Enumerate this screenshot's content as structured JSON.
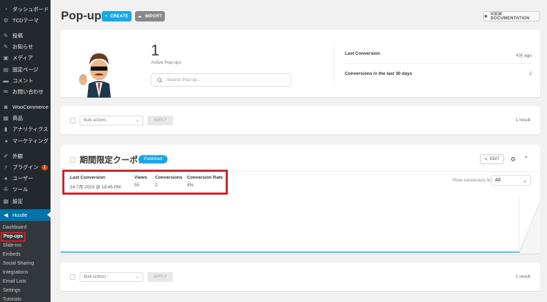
{
  "sidebar": {
    "items": [
      {
        "label": "ダッシュボード",
        "icon": "dashboard-icon"
      },
      {
        "label": "TCDテーマ",
        "icon": "gear-icon"
      },
      {
        "label": "投稿",
        "icon": "pin-icon"
      },
      {
        "label": "お知らせ",
        "icon": "pin-icon"
      },
      {
        "label": "メディア",
        "icon": "media-icon"
      },
      {
        "label": "固定ページ",
        "icon": "page-icon"
      },
      {
        "label": "コメント",
        "icon": "comment-icon"
      },
      {
        "label": "お問い合わせ",
        "icon": "mail-icon"
      },
      {
        "label": "WooCommerce",
        "icon": "woocommerce-icon"
      },
      {
        "label": "商品",
        "icon": "products-icon"
      },
      {
        "label": "アナリティクス",
        "icon": "analytics-icon"
      },
      {
        "label": "マーケティング",
        "icon": "megaphone-icon"
      },
      {
        "label": "外観",
        "icon": "brush-icon"
      },
      {
        "label": "プラグイン",
        "icon": "plugin-icon",
        "badge": "1"
      },
      {
        "label": "ユーザー",
        "icon": "user-icon"
      },
      {
        "label": "ツール",
        "icon": "wrench-icon"
      },
      {
        "label": "設定",
        "icon": "settings-icon"
      }
    ],
    "hustle": {
      "label": "Hustle",
      "icon": "hustle-icon"
    },
    "sub_items": [
      "Dashboard",
      "Pop-ups",
      "Slide-ins",
      "Embeds",
      "Social Sharing",
      "Integrations",
      "Email Lists",
      "Settings",
      "Tutorials"
    ]
  },
  "header": {
    "title": "Pop-ups",
    "create_label": "CREATE",
    "import_label": "IMPORT",
    "docs_label": "VIEW DOCUMENTATION"
  },
  "summary": {
    "count": "1",
    "count_label": "Active Pop-ups",
    "search_placeholder": "Search Pop-up...",
    "last_conversion_label": "Last Conversion",
    "last_conversion_value": "4分 ago",
    "conversions_30_label": "Conversions in the last 30 days",
    "conversions_30_value": "2"
  },
  "bulk": {
    "select_label": "Bulk actions",
    "apply_label": "APPLY",
    "result_label": "1 result"
  },
  "module": {
    "title": "期間限定クーポン",
    "status": "Published",
    "edit_label": "EDIT",
    "stats": {
      "last_conversion_label": "Last Conversion",
      "last_conversion_value": "24 7月 2023 @ 18:45 PM",
      "views_label": "Views",
      "views_value": "50",
      "conversions_label": "Conversions",
      "conversions_value": "2",
      "rate_label": "Conversion Rate",
      "rate_value": "4%"
    },
    "show_conversions_label": "Show conversions for",
    "show_conversions_value": "All"
  },
  "colors": {
    "accent": "#17a8e3",
    "sidebar_bg": "#23282d",
    "active_menu": "#0073aa",
    "highlight": "#c62424"
  }
}
